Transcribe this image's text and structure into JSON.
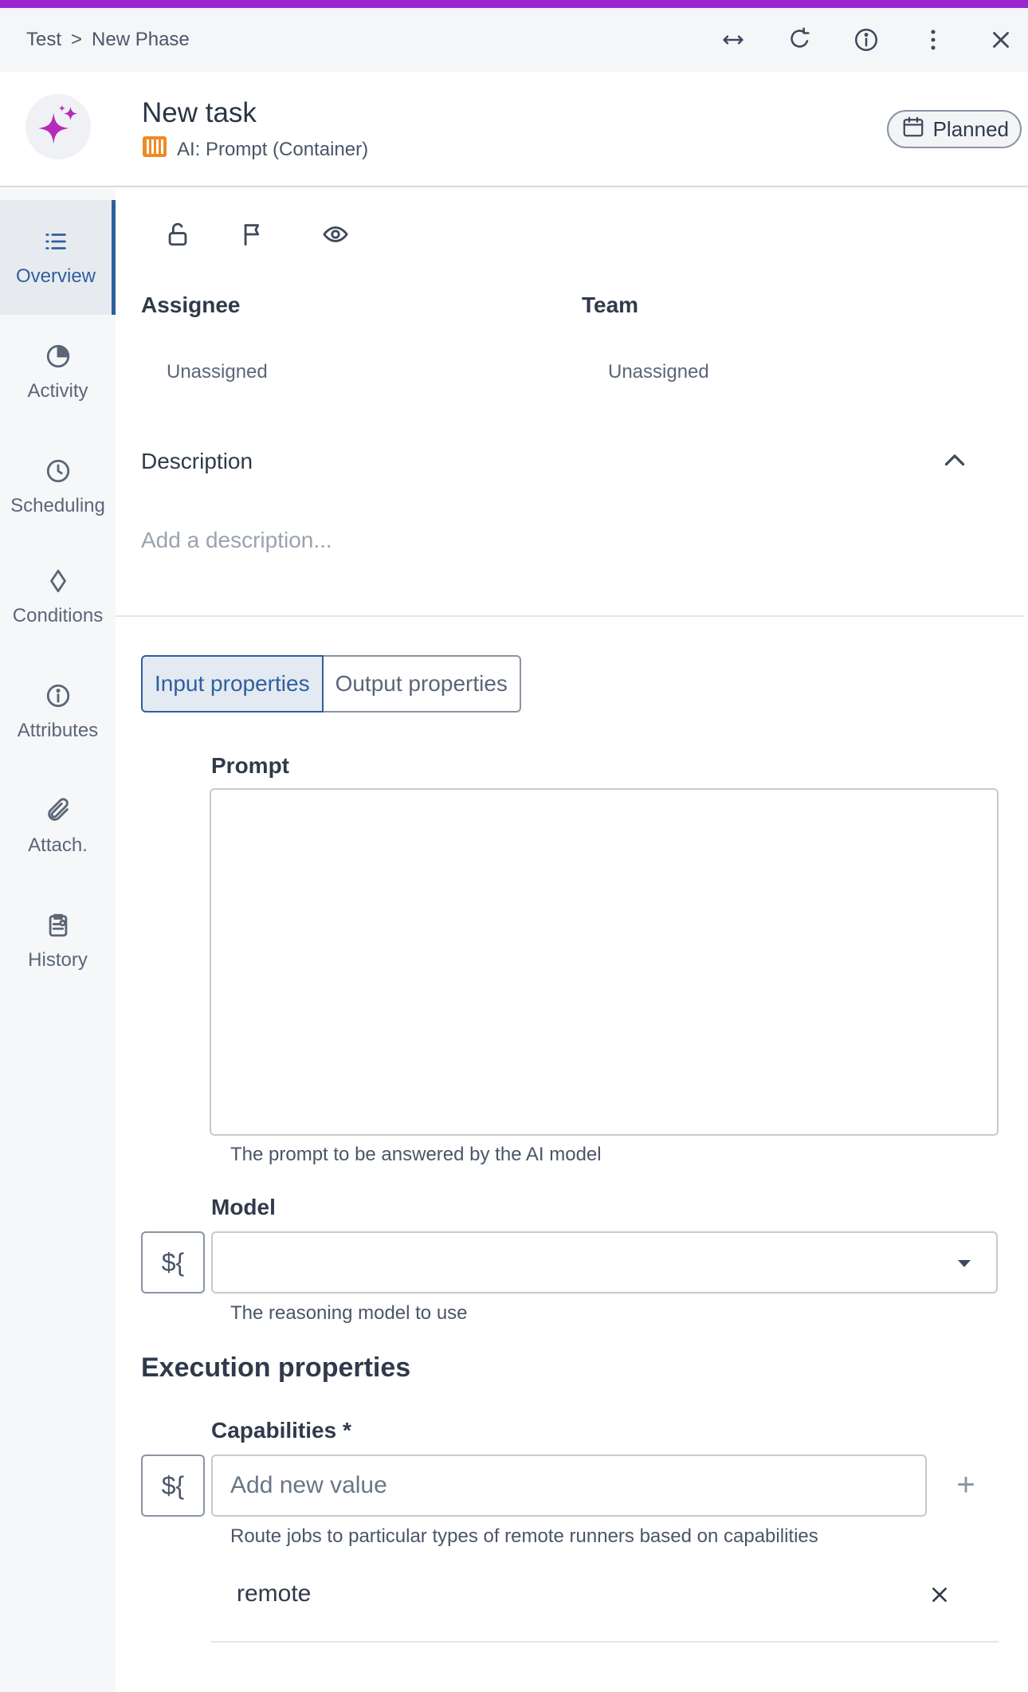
{
  "colors": {
    "accent": "#9c27d0",
    "active": "#2f5f9e",
    "type_icon": "#f08a24"
  },
  "breadcrumb": {
    "parent": "Test",
    "separator": ">",
    "current": "New Phase"
  },
  "top_icons": [
    "expand-horizontal-icon",
    "refresh-icon",
    "info-icon",
    "more-vertical-icon",
    "close-icon"
  ],
  "header": {
    "title": "New task",
    "type_label": "AI: Prompt (Container)",
    "status": "Planned"
  },
  "sidebar": {
    "items": [
      {
        "label": "Overview",
        "icon": "list-icon"
      },
      {
        "label": "Activity",
        "icon": "pie-icon"
      },
      {
        "label": "Scheduling",
        "icon": "clock-icon"
      },
      {
        "label": "Conditions",
        "icon": "diamond-icon"
      },
      {
        "label": "Attributes",
        "icon": "info-icon"
      },
      {
        "label": "Attach.",
        "icon": "paperclip-icon"
      },
      {
        "label": "History",
        "icon": "clipboard-icon"
      }
    ]
  },
  "toolbar_icons": [
    "unlock-icon",
    "flag-icon",
    "eye-icon"
  ],
  "assignee": {
    "label": "Assignee",
    "value": "Unassigned"
  },
  "team": {
    "label": "Team",
    "value": "Unassigned"
  },
  "description": {
    "label": "Description",
    "placeholder": "Add a description..."
  },
  "tabs": [
    {
      "label": "Input properties",
      "active": true
    },
    {
      "label": "Output properties",
      "active": false
    }
  ],
  "prompt": {
    "label": "Prompt",
    "help": "The prompt to be answered by the AI model"
  },
  "model": {
    "label": "Model",
    "help": "The reasoning model to use",
    "expr_label": "${"
  },
  "execution": {
    "title": "Execution properties"
  },
  "capabilities": {
    "label": "Capabilities *",
    "placeholder": "Add new value",
    "help": "Route jobs to particular types of remote runners based on capabilities",
    "expr_label": "${",
    "add_label": "+",
    "values": [
      "remote"
    ]
  }
}
